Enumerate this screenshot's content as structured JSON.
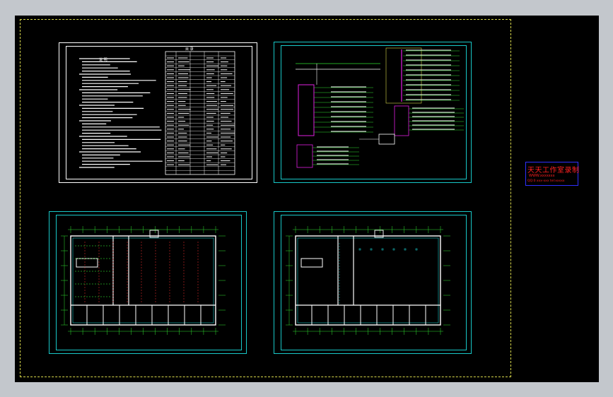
{
  "stamp": {
    "title": "天天工作室录制",
    "line1": "WWW.xxxxxxx",
    "line2": "QQ:0 xxx-xxx tel:xxxxx"
  },
  "sheets": {
    "notes": {
      "heading": "说 明",
      "table_heading": "目 录"
    }
  },
  "colors": {
    "background": "#000000",
    "frame_white": "#ffffff",
    "frame_cyan": "#18c8c8",
    "wire_green": "#30e030",
    "bus_magenta": "#e020e0",
    "label_red": "#ff2020"
  }
}
